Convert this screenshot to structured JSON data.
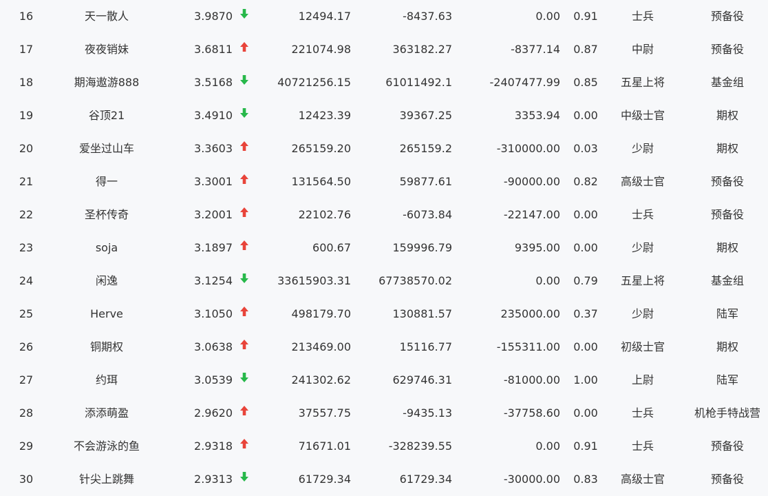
{
  "colors": {
    "up": "#e8443a",
    "down": "#27b84a",
    "text": "#333333",
    "background": "#f7f8fa"
  },
  "rows": [
    {
      "rank": "16",
      "name": "天一散人",
      "ratio": "3.9870",
      "trend": "down",
      "a": "12494.17",
      "b": "-8437.63",
      "c": "0.00",
      "d": "0.91",
      "level": "士兵",
      "group": "预备役"
    },
    {
      "rank": "17",
      "name": "夜夜销妹",
      "ratio": "3.6811",
      "trend": "up",
      "a": "221074.98",
      "b": "363182.27",
      "c": "-8377.14",
      "d": "0.87",
      "level": "中尉",
      "group": "预备役"
    },
    {
      "rank": "18",
      "name": "期海遨游888",
      "ratio": "3.5168",
      "trend": "down",
      "a": "40721256.15",
      "b": "61011492.1",
      "c": "-2407477.99",
      "d": "0.85",
      "level": "五星上将",
      "group": "基金组"
    },
    {
      "rank": "19",
      "name": "谷顶21",
      "ratio": "3.4910",
      "trend": "down",
      "a": "12423.39",
      "b": "39367.25",
      "c": "3353.94",
      "d": "0.00",
      "level": "中级士官",
      "group": "期权"
    },
    {
      "rank": "20",
      "name": "爱坐过山车",
      "ratio": "3.3603",
      "trend": "up",
      "a": "265159.20",
      "b": "265159.2",
      "c": "-310000.00",
      "d": "0.03",
      "level": "少尉",
      "group": "期权"
    },
    {
      "rank": "21",
      "name": "得一",
      "ratio": "3.3001",
      "trend": "up",
      "a": "131564.50",
      "b": "59877.61",
      "c": "-90000.00",
      "d": "0.82",
      "level": "高级士官",
      "group": "预备役"
    },
    {
      "rank": "22",
      "name": "圣杯传奇",
      "ratio": "3.2001",
      "trend": "up",
      "a": "22102.76",
      "b": "-6073.84",
      "c": "-22147.00",
      "d": "0.00",
      "level": "士兵",
      "group": "预备役"
    },
    {
      "rank": "23",
      "name": "soja",
      "ratio": "3.1897",
      "trend": "up",
      "a": "600.67",
      "b": "159996.79",
      "c": "9395.00",
      "d": "0.00",
      "level": "少尉",
      "group": "期权"
    },
    {
      "rank": "24",
      "name": "闲逸",
      "ratio": "3.1254",
      "trend": "down",
      "a": "33615903.31",
      "b": "67738570.02",
      "c": "0.00",
      "d": "0.79",
      "level": "五星上将",
      "group": "基金组"
    },
    {
      "rank": "25",
      "name": "Herve",
      "ratio": "3.1050",
      "trend": "up",
      "a": "498179.70",
      "b": "130881.57",
      "c": "235000.00",
      "d": "0.37",
      "level": "少尉",
      "group": "陆军"
    },
    {
      "rank": "26",
      "name": "铜期权",
      "ratio": "3.0638",
      "trend": "up",
      "a": "213469.00",
      "b": "15116.77",
      "c": "-155311.00",
      "d": "0.00",
      "level": "初级士官",
      "group": "期权"
    },
    {
      "rank": "27",
      "name": "约珥",
      "ratio": "3.0539",
      "trend": "down",
      "a": "241302.62",
      "b": "629746.31",
      "c": "-81000.00",
      "d": "1.00",
      "level": "上尉",
      "group": "陆军"
    },
    {
      "rank": "28",
      "name": "添添萌盈",
      "ratio": "2.9620",
      "trend": "up",
      "a": "37557.75",
      "b": "-9435.13",
      "c": "-37758.60",
      "d": "0.00",
      "level": "士兵",
      "group": "机枪手特战营"
    },
    {
      "rank": "29",
      "name": "不会游泳的鱼",
      "ratio": "2.9318",
      "trend": "up",
      "a": "71671.01",
      "b": "-328239.55",
      "c": "0.00",
      "d": "0.91",
      "level": "士兵",
      "group": "预备役"
    },
    {
      "rank": "30",
      "name": "针尖上跳舞",
      "ratio": "2.9313",
      "trend": "down",
      "a": "61729.34",
      "b": "61729.34",
      "c": "-30000.00",
      "d": "0.83",
      "level": "高级士官",
      "group": "预备役"
    }
  ]
}
